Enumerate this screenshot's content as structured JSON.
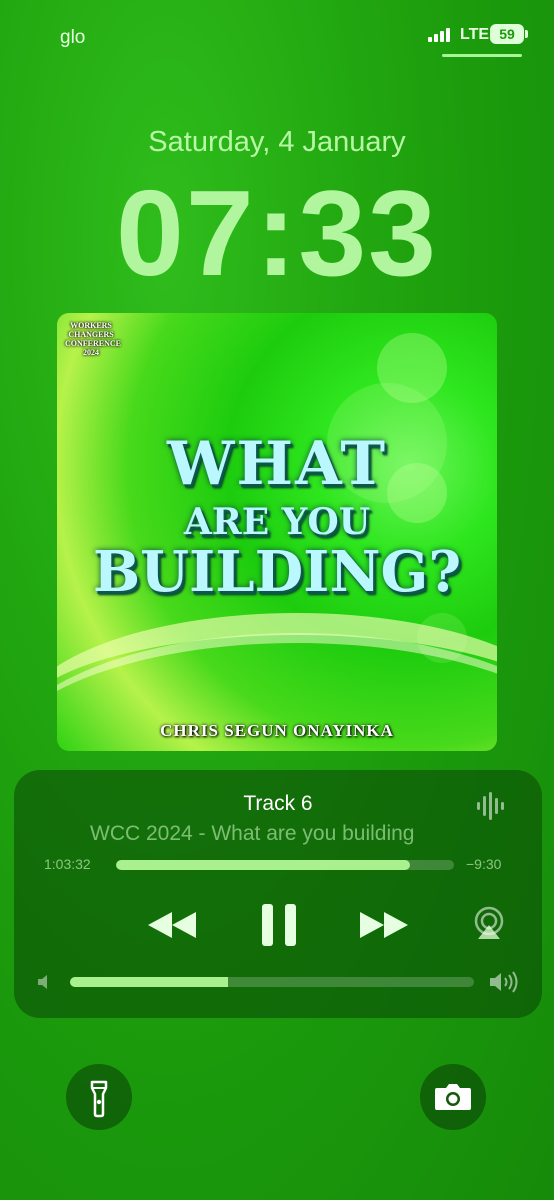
{
  "status_bar": {
    "carrier": "glo",
    "network": "LTE",
    "battery": "59"
  },
  "lock_screen": {
    "date": "Saturday, 4 January",
    "time": "07:33"
  },
  "artwork": {
    "logo_text": "WORKERS CHANGERS CONFERENCE 2024",
    "title_line1": "WHAT",
    "title_line2": "ARE YOU",
    "title_line3": "BUILDING?",
    "artist": "CHRIS SEGUN ONAYINKA"
  },
  "now_playing": {
    "track_title": "Track 6",
    "subtitle": "WCC 2024 - What are you building",
    "elapsed": "1:03:32",
    "remaining": "−9:30",
    "progress": 0.87,
    "volume": 0.39
  },
  "quick_actions": {
    "left_icon": "flashlight-icon",
    "right_icon": "camera-icon"
  },
  "colors": {
    "background": "#22a710",
    "accent": "#a9f08f",
    "time_text": "#b1f59f"
  }
}
